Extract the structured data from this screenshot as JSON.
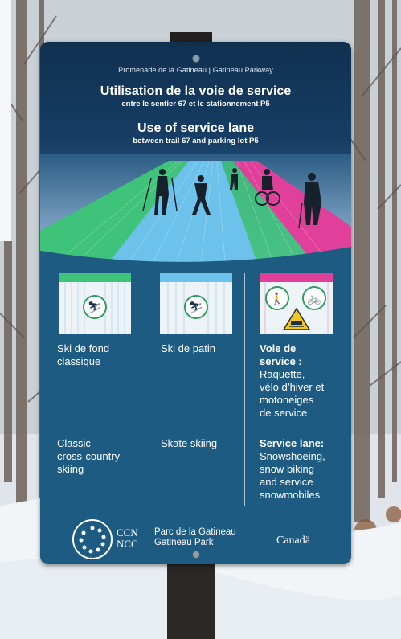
{
  "sign": {
    "park_line": "Promenade de la Gatineau | Gatineau Parkway",
    "title_fr": "Utilisation de la voie de service",
    "subtitle_fr": "entre le sentier 67 et le stationnement P5",
    "title_en": "Use of service lane",
    "subtitle_en": "between trail 67 and parking lot P5"
  },
  "columns": [
    {
      "bar_color": "#3fc27a",
      "stripe_color": "#cde6f4",
      "fr_lines": [
        "Ski de fond",
        "classique"
      ],
      "en_lines": [
        "Classic",
        "cross-country",
        "skiing"
      ],
      "icons": [
        "classic-ski-icon"
      ],
      "bold": false
    },
    {
      "bar_color": "#6cc2ea",
      "stripe_color": "#d0e4f2",
      "fr_lines": [
        "Ski de patin"
      ],
      "en_lines": [
        "Skate skiing"
      ],
      "icons": [
        "skate-ski-icon"
      ],
      "bold": false
    },
    {
      "bar_color": "#e0409a",
      "stripe_color": "#f2d8e8",
      "fr_title_lines": [
        "Voie de",
        "service :"
      ],
      "fr_lines": [
        "Raquette,",
        "vélo d’hiver et",
        "motoneiges",
        "de service"
      ],
      "en_title_line": "Service lane:",
      "en_lines": [
        "Snowshoeing,",
        "snow biking",
        "and service",
        "snowmobiles"
      ],
      "icons": [
        "snowshoe-icon",
        "bike-icon",
        "snowmobile-warning-icon"
      ],
      "bold": true
    }
  ],
  "footer": {
    "ccn_line1": "CCN",
    "ccn_line2": "NCC",
    "park_fr": "Parc de la Gatineau",
    "park_en": "Gatineau Park",
    "canada": "Canadä"
  },
  "colors": {
    "sign_blue": "#1d5b82",
    "lane_green": "#3fc27a",
    "lane_blue": "#6cc2ea",
    "lane_pink": "#e0409a"
  }
}
